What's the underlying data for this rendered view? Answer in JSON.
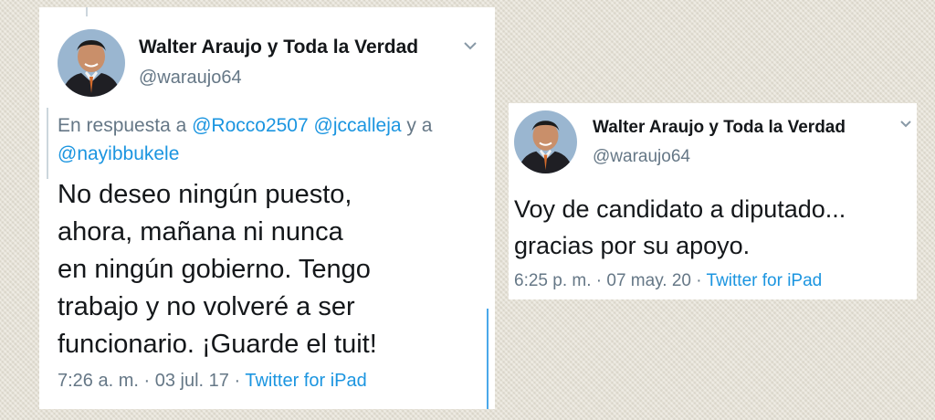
{
  "colors": {
    "background": "#e6e2d6",
    "card": "#ffffff",
    "name": "#14171a",
    "secondary": "#657786",
    "link": "#1b95e0"
  },
  "tweet_1": {
    "author_name": "Walter Araujo y Toda la Verdad",
    "author_handle": "@waraujo64",
    "reply_prefix": "En respuesta a",
    "reply_mentions": [
      "@Rocco2507",
      "@jccalleja"
    ],
    "reply_and": "y a",
    "reply_mention_last": "@nayibbukele",
    "text_lines": [
      "No deseo ningún puesto,",
      "ahora, mañana ni nunca",
      "en ningún gobierno. Tengo",
      "trabajo y no volveré a ser",
      "funcionario. ¡Guarde el tuit!"
    ],
    "time": "7:26 a. m.",
    "date": "03 jul. 17",
    "separator": "·",
    "source": "Twitter for iPad",
    "icons": {
      "menu": "chevron-down-icon",
      "avatar": "profile-photo"
    }
  },
  "tweet_2": {
    "author_name": "Walter Araujo y Toda la Verdad",
    "author_handle": "@waraujo64",
    "text_lines": [
      "Voy de candidato a diputado...",
      "gracias por su apoyo."
    ],
    "time": "6:25 p. m.",
    "date": "07 may. 20",
    "separator": "·",
    "source": "Twitter for iPad",
    "icons": {
      "menu": "chevron-down-icon",
      "avatar": "profile-photo"
    }
  }
}
